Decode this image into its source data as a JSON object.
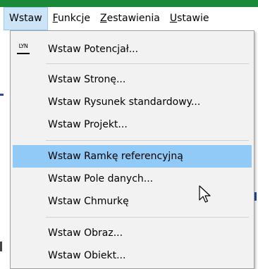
{
  "menubar": {
    "items": [
      {
        "label": "Wstaw"
      },
      {
        "prefix": "",
        "mnemonic": "F",
        "rest": "unkcje"
      },
      {
        "prefix": "",
        "mnemonic": "Z",
        "rest": "estawienia"
      },
      {
        "prefix": "",
        "mnemonic": "U",
        "rest": "stawie"
      }
    ]
  },
  "dropdown": {
    "items": [
      {
        "label": "Wstaw Potencjał...",
        "icon": "lyn-icon"
      },
      {
        "label": "Wstaw Stronę..."
      },
      {
        "label": "Wstaw Rysunek standardowy..."
      },
      {
        "label": "Wstaw Projekt..."
      },
      {
        "label": "Wstaw Ramkę referencyjną",
        "highlighted": true
      },
      {
        "label": "Wstaw Pole danych..."
      },
      {
        "label": "Wstaw Chmurkę"
      },
      {
        "label": "Wstaw Obraz..."
      },
      {
        "label": "Wstaw Obiekt..."
      }
    ]
  },
  "icons": {
    "lyn_icon_text": "LYN"
  },
  "colors": {
    "highlight": "#91c9f7",
    "active_menu": "#cce4f7",
    "menu_bg": "#f2f2f2",
    "top_strip": "#1a8a3a"
  }
}
